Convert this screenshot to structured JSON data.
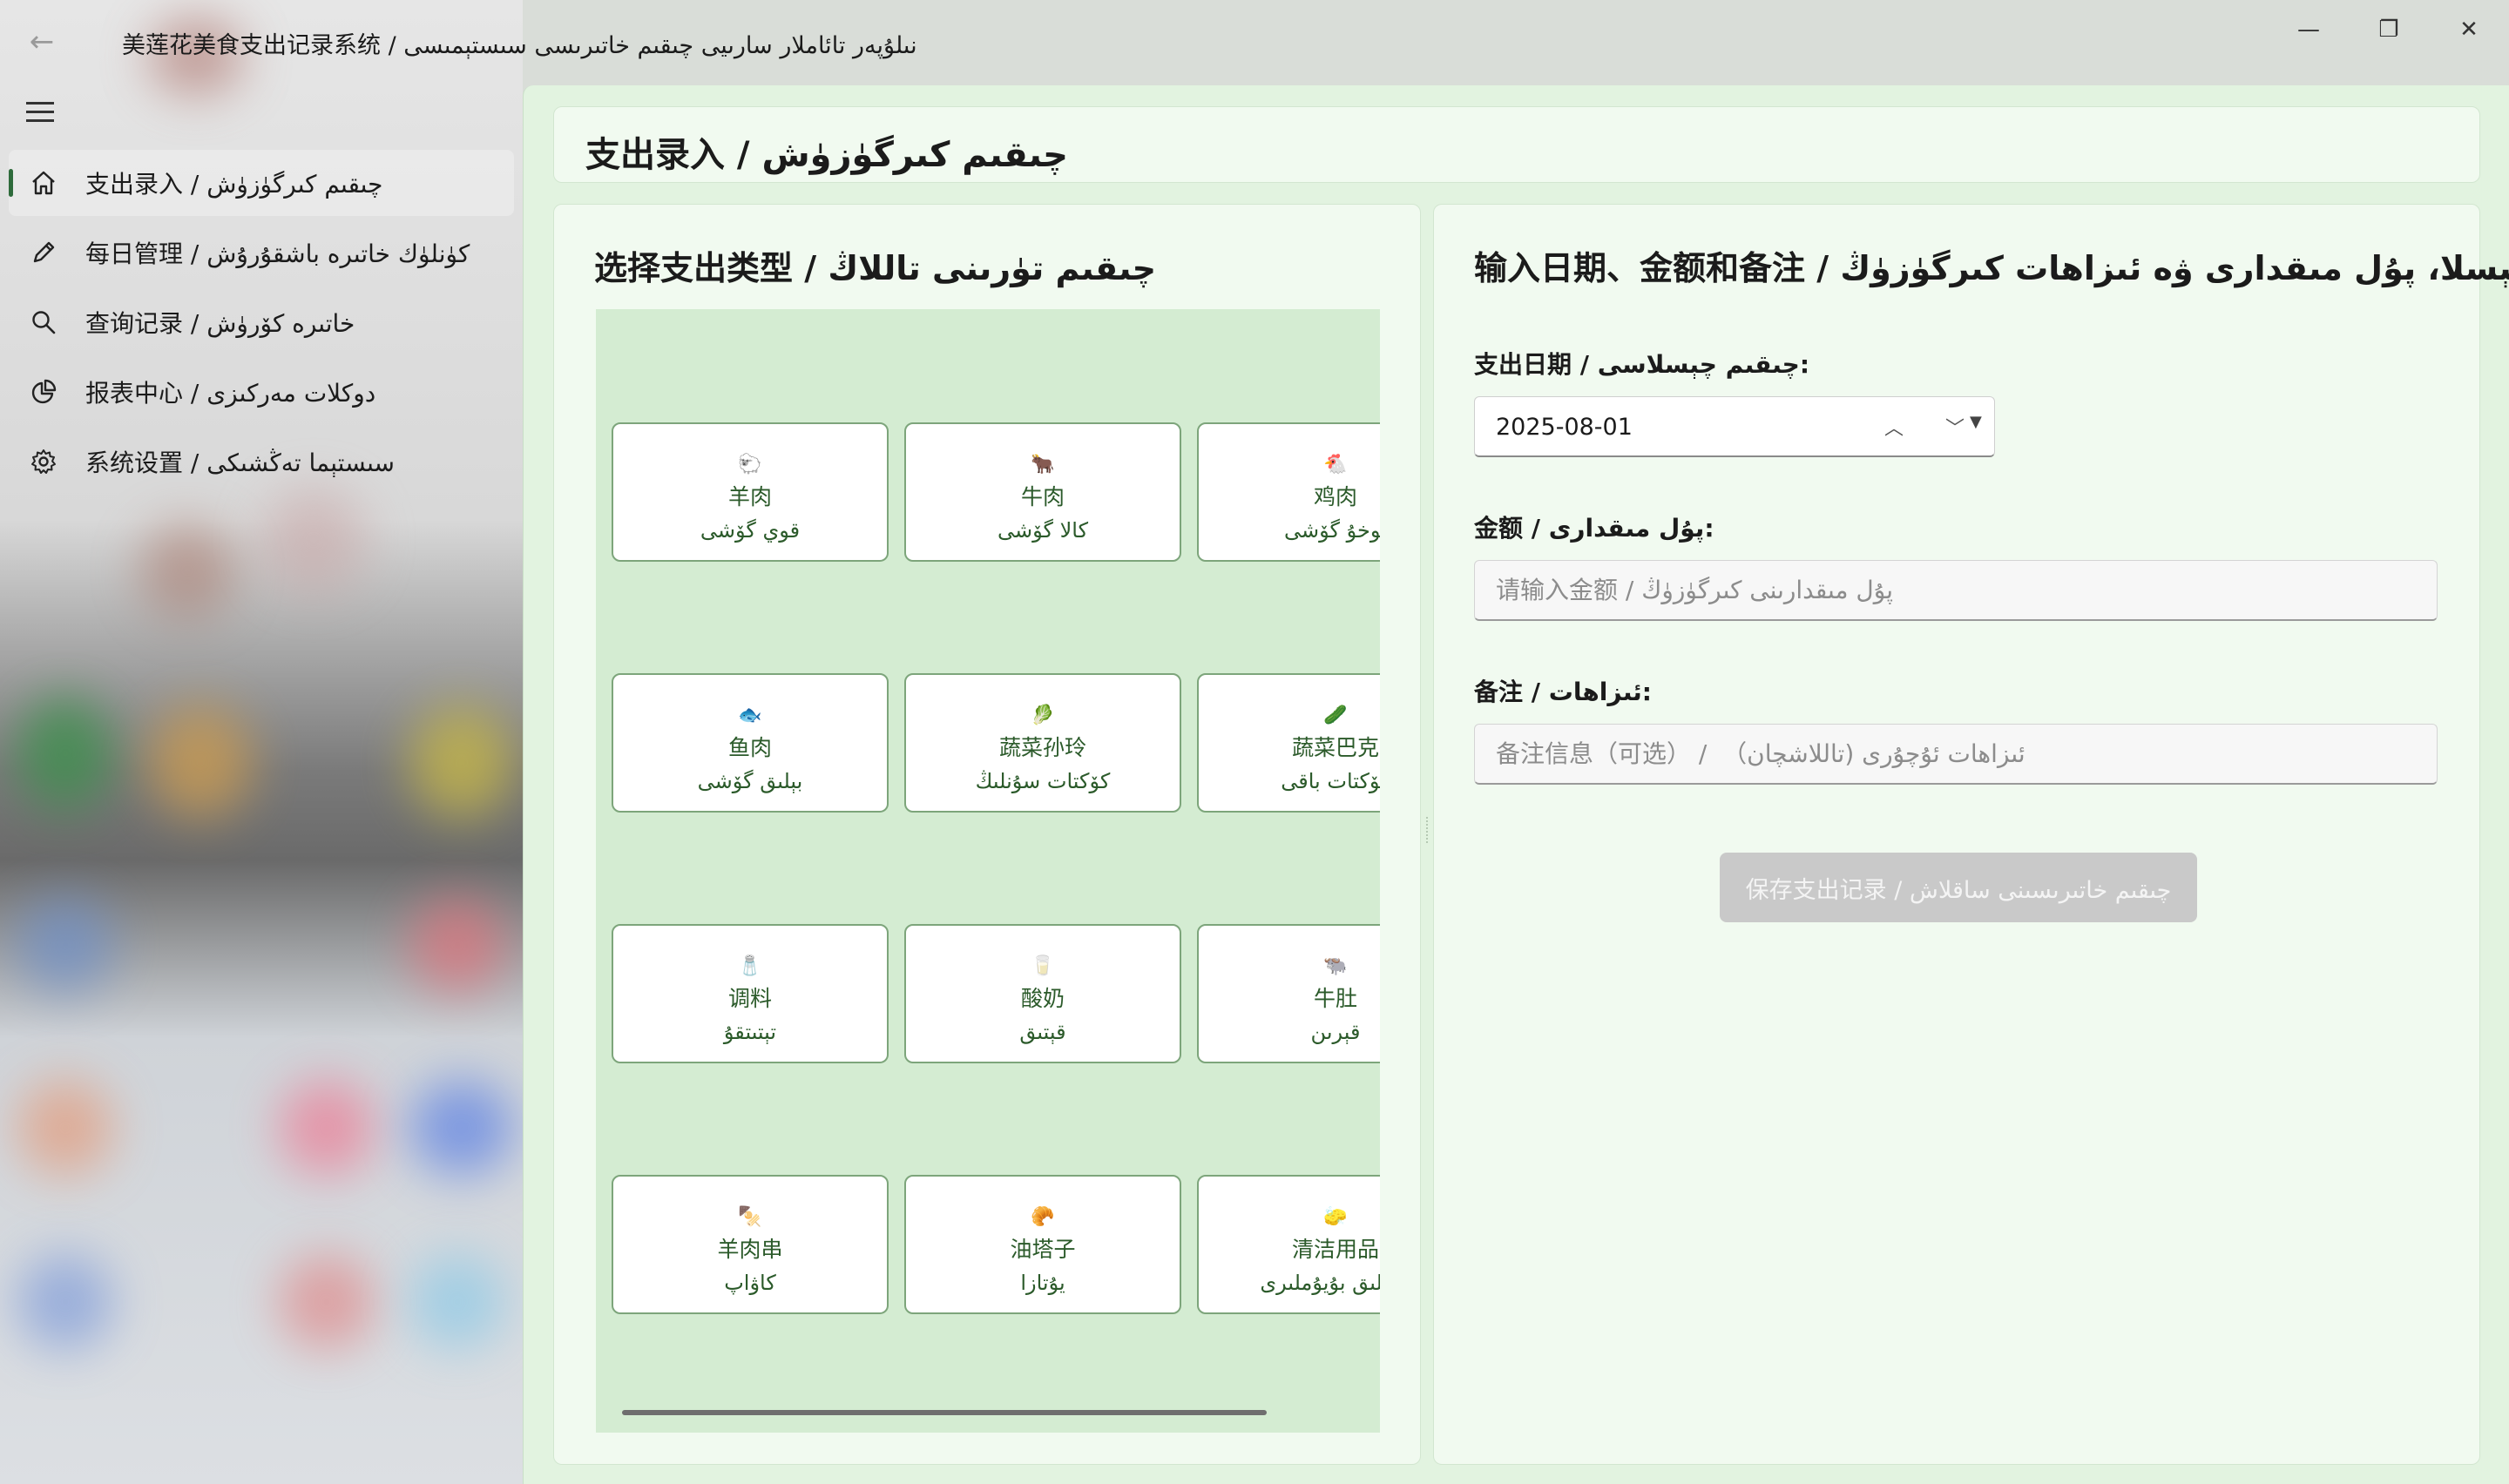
{
  "window": {
    "title": "美莲花美食支出记录系统 / نىلۇپەر تائاملار سارىيى چىقىم خاتىرىسى سىستېمىسى",
    "back_icon": "arrow-left-icon",
    "controls": {
      "minimize": "—",
      "maximize": "❐",
      "close": "✕"
    }
  },
  "sidebar": {
    "menu_icon": "hamburger-icon",
    "items": [
      {
        "label": "支出录入 / چىقىم كىرگۈزۈش",
        "icon": "home-icon",
        "active": true
      },
      {
        "label": "每日管理 / كۈنلۈك خاتىرە باشقۇرۇش",
        "icon": "pencil-icon",
        "active": false
      },
      {
        "label": "查询记录 / خاتىرە كۆرۈش",
        "icon": "search-icon",
        "active": false
      },
      {
        "label": "报表中心 / دوكلات مەركىزى",
        "icon": "pie-chart-icon",
        "active": false
      },
      {
        "label": "系统设置 / سىستېما تەڭشىكى",
        "icon": "gear-icon",
        "active": false
      }
    ]
  },
  "header": {
    "title": "支出录入 / چىقىم كىرگۈزۈش"
  },
  "category_panel": {
    "title": "选择支出类型 / چىقىم تۈرىنى تاللاڭ",
    "categories": [
      {
        "icon": "🐑",
        "cn": "羊肉",
        "ug": "قوي گۆشى"
      },
      {
        "icon": "🐂",
        "cn": "牛肉",
        "ug": "كالا گۆشى"
      },
      {
        "icon": "🐔",
        "cn": "鸡肉",
        "ug": "توخۇ گۆشى"
      },
      {
        "icon": "🐟",
        "cn": "鱼肉",
        "ug": "بېلىق گۆشى"
      },
      {
        "icon": "🥬",
        "cn": "蔬菜孙玲",
        "ug": "كۆكتات سۇنلىڭ"
      },
      {
        "icon": "🥒",
        "cn": "蔬菜巴克",
        "ug": "كۆكتات باقى"
      },
      {
        "icon": "🧂",
        "cn": "调料",
        "ug": "تېتىتقۇ"
      },
      {
        "icon": "🥛",
        "cn": "酸奶",
        "ug": "قېتىق"
      },
      {
        "icon": "🐃",
        "cn": "牛肚",
        "ug": "قېرىن"
      },
      {
        "icon": "🍢",
        "cn": "羊肉串",
        "ug": "كاۋاپ"
      },
      {
        "icon": "🥐",
        "cn": "油塔子",
        "ug": "يۇتازا"
      },
      {
        "icon": "🧽",
        "cn": "清洁用品",
        "ug": "تازىلىق بۇيۇملىرى"
      }
    ]
  },
  "entry_panel": {
    "title": "输入日期、金额和备注 / چېسلا، پۇل مىقدارى ۋە ئىزاھات كىرگۈزۈڭ",
    "date_label": "支出日期 / چىقىم چېسلاسى:",
    "date_value": "2025-08-01",
    "amount_label": "金额 / پۇل مىقدارى:",
    "amount_placeholder": "请输入金额 / پۇل مىقدارىنى كىرگۈزۈڭ",
    "amount_value": "",
    "note_label": "备注 / ئىزاھات:",
    "note_placeholder": "备注信息（可选） /  （ئىزاھات ئۇچۇرى (تاللاشچان",
    "note_value": "",
    "save_label": "保存支出记录 / چىقىم خاتىرىسىنى ساقلاش"
  }
}
